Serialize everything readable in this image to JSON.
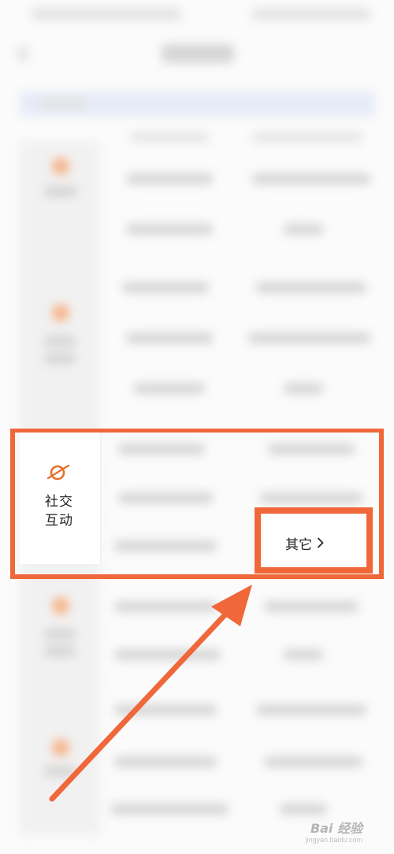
{
  "category": {
    "icon": "planet-icon",
    "label_line1": "社交",
    "label_line2": "互动"
  },
  "other_link": {
    "label": "其它",
    "chevron": "chevron-right-icon"
  },
  "watermark": {
    "text": "Bai 经验",
    "sub": "jingyan.baidu.com"
  },
  "colors": {
    "highlight": "#f0673a",
    "icon_orange": "#e4722f"
  }
}
